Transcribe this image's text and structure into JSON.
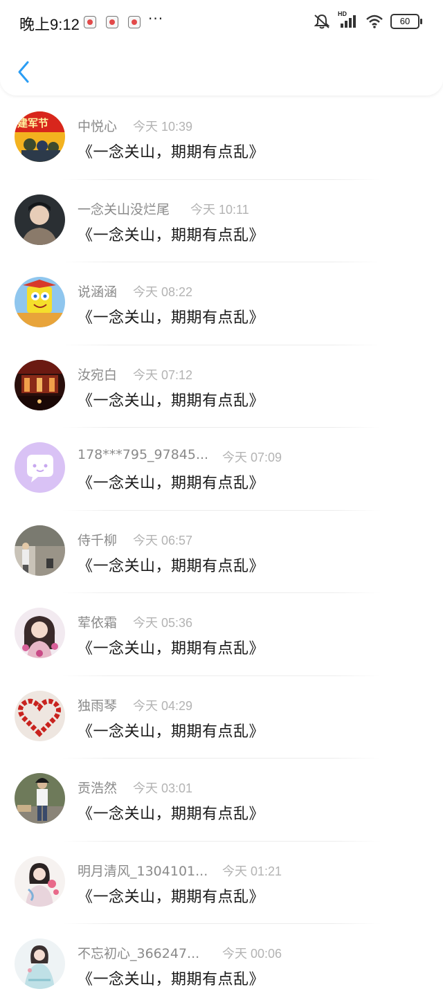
{
  "status_bar": {
    "time": "晚上9:12",
    "more": "···",
    "network": "HD",
    "battery": "60"
  },
  "nav": {
    "back_icon": "chevron-left-icon",
    "accent_color": "#2a9df4"
  },
  "items": [
    {
      "user": "中悦心",
      "time": "今天 10:39",
      "message": "《一念关山，期期有点乱》"
    },
    {
      "user": "一念关山没烂尾",
      "time": "今天 10:11",
      "message": "《一念关山，期期有点乱》"
    },
    {
      "user": "说涵涵",
      "time": "今天 08:22",
      "message": "《一念关山，期期有点乱》"
    },
    {
      "user": "汝宛白",
      "time": "今天 07:12",
      "message": "《一念关山，期期有点乱》"
    },
    {
      "user": "178***795_97845...",
      "time": "今天 07:09",
      "message": "《一念关山，期期有点乱》"
    },
    {
      "user": "侍千柳",
      "time": "今天 06:57",
      "message": "《一念关山，期期有点乱》"
    },
    {
      "user": "荤依霜",
      "time": "今天 05:36",
      "message": "《一念关山，期期有点乱》"
    },
    {
      "user": "独雨琴",
      "time": "今天 04:29",
      "message": "《一念关山，期期有点乱》"
    },
    {
      "user": "贡浩然",
      "time": "今天 03:01",
      "message": "《一念关山，期期有点乱》"
    },
    {
      "user": "明月清风_1304101...",
      "time": "今天 01:21",
      "message": "《一念关山，期期有点乱》"
    },
    {
      "user": "不忘初心_366247...",
      "time": "今天 00:06",
      "message": "《一念关山，期期有点乱》"
    }
  ]
}
